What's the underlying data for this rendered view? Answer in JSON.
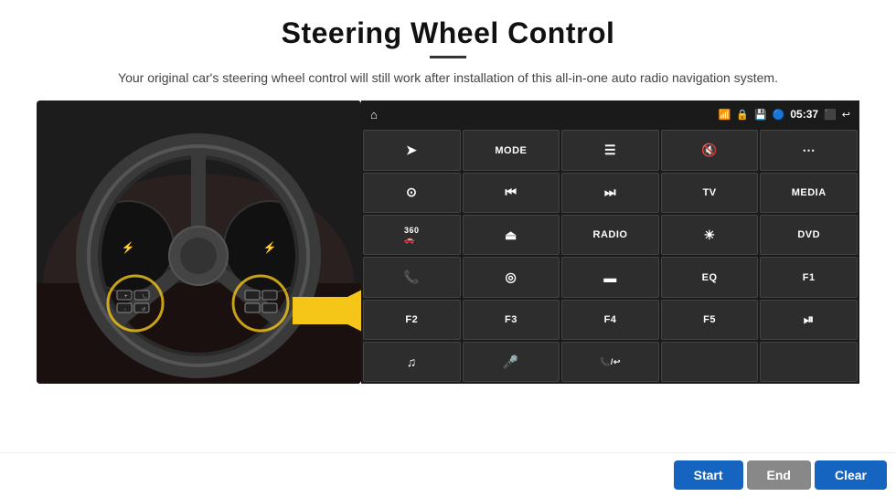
{
  "header": {
    "title": "Steering Wheel Control",
    "subtitle": "Your original car's steering wheel control will still work after installation of this all-in-one auto radio navigation system."
  },
  "statusBar": {
    "time": "05:37",
    "icons": [
      "home",
      "wifi",
      "lock",
      "sd",
      "bluetooth",
      "cast",
      "back"
    ]
  },
  "buttons": [
    {
      "row": 1,
      "cells": [
        {
          "icon": "➤",
          "label": "",
          "type": "icon"
        },
        {
          "icon": "",
          "label": "MODE",
          "type": "text"
        },
        {
          "icon": "≡",
          "label": "",
          "type": "icon"
        },
        {
          "icon": "🔇",
          "label": "",
          "type": "icon"
        },
        {
          "icon": "⋯",
          "label": "",
          "type": "icon"
        }
      ]
    },
    {
      "row": 2,
      "cells": [
        {
          "icon": "⊙",
          "label": "",
          "type": "icon"
        },
        {
          "icon": "⏮",
          "label": "",
          "type": "icon"
        },
        {
          "icon": "⏭",
          "label": "",
          "type": "icon"
        },
        {
          "icon": "",
          "label": "TV",
          "type": "text"
        },
        {
          "icon": "",
          "label": "MEDIA",
          "type": "text"
        }
      ]
    },
    {
      "row": 3,
      "cells": [
        {
          "icon": "360",
          "label": "",
          "type": "small"
        },
        {
          "icon": "▲",
          "label": "",
          "type": "icon"
        },
        {
          "icon": "",
          "label": "RADIO",
          "type": "text"
        },
        {
          "icon": "☀",
          "label": "",
          "type": "icon"
        },
        {
          "icon": "",
          "label": "DVD",
          "type": "text"
        }
      ]
    },
    {
      "row": 4,
      "cells": [
        {
          "icon": "📞",
          "label": "",
          "type": "icon"
        },
        {
          "icon": "◎",
          "label": "",
          "type": "icon"
        },
        {
          "icon": "▬",
          "label": "",
          "type": "icon"
        },
        {
          "icon": "",
          "label": "EQ",
          "type": "text"
        },
        {
          "icon": "",
          "label": "F1",
          "type": "text"
        }
      ]
    },
    {
      "row": 5,
      "cells": [
        {
          "icon": "",
          "label": "F2",
          "type": "text"
        },
        {
          "icon": "",
          "label": "F3",
          "type": "text"
        },
        {
          "icon": "",
          "label": "F4",
          "type": "text"
        },
        {
          "icon": "",
          "label": "F5",
          "type": "text"
        },
        {
          "icon": "⏯",
          "label": "",
          "type": "icon"
        }
      ]
    },
    {
      "row": 6,
      "cells": [
        {
          "icon": "♫",
          "label": "",
          "type": "icon"
        },
        {
          "icon": "🎤",
          "label": "",
          "type": "icon"
        },
        {
          "icon": "📞/↩",
          "label": "",
          "type": "small"
        },
        {
          "icon": "",
          "label": "",
          "type": "empty"
        },
        {
          "icon": "",
          "label": "",
          "type": "empty"
        }
      ]
    }
  ],
  "bottomBar": {
    "start_label": "Start",
    "end_label": "End",
    "clear_label": "Clear"
  }
}
